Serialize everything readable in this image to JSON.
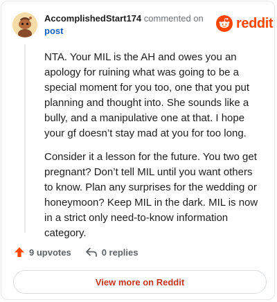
{
  "comment": {
    "author": "AccomplishedStart174",
    "action_text": "commented on",
    "post_link_label": "post",
    "paragraphs": [
      "NTA. Your MIL is the AH and owes you an apology for ruining what was going to be a special moment for you too, one that you put planning and thought into. She sounds like a bully, and a manipulative one at that. I hope your gf doesn’t stay mad at you for too long.",
      "Consider it a lesson for the future. You two get pregnant? Don’t tell MIL until you want others to know. Plan any surprises for the wedding or honeymoon? Keep MIL in the dark. MIL is now in a strict only need-to-know information category."
    ],
    "upvotes_label": "9 upvotes",
    "replies_label": "0 replies"
  },
  "brand": {
    "wordmark": "reddit",
    "color": "#ff4500"
  },
  "footer": {
    "view_more_label": "View more on Reddit"
  },
  "icons": {
    "upvote": "upvote-arrow-icon",
    "reply": "reply-arrow-icon",
    "brand": "reddit-snoo-icon",
    "avatar": "snoo-avatar"
  }
}
